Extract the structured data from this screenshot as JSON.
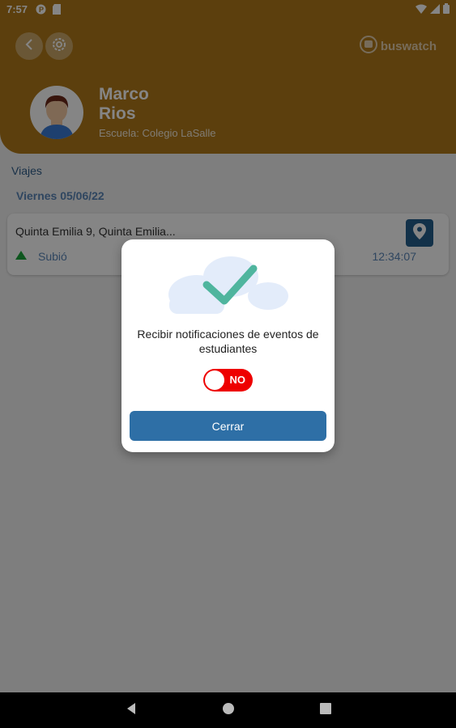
{
  "status_bar": {
    "time": "7:57",
    "icons": [
      "p-circle-icon",
      "sd-card-icon",
      "wifi-icon",
      "signal-icon",
      "battery-icon"
    ]
  },
  "header": {
    "back_icon": "chevron-left-icon",
    "settings_icon": "gear-icon",
    "brand_name": "buswatch",
    "student_first_name": "Marco",
    "student_last_name": "Rios",
    "school": "Escuela: Colegio LaSalle",
    "color": "#b17a1a"
  },
  "content": {
    "section_title": "Viajes",
    "date": "Viernes 05/06/22",
    "trip": {
      "address": "Quinta Emilia 9, Quinta Emilia...",
      "status": "Subió",
      "status_color": "#1aa53a",
      "time": "12:34:07",
      "map_icon": "map-pin-icon"
    }
  },
  "dialog": {
    "illustration": "cloud-check-icon",
    "message": "Recibir notificaciones de eventos de estudiantes",
    "toggle": {
      "state": "off",
      "label": "NO",
      "color": "#ee0000"
    },
    "close_label": "Cerrar",
    "button_color": "#2e6fa6"
  },
  "nav": {
    "back_icon": "nav-back-icon",
    "home_icon": "nav-home-icon",
    "recents_icon": "nav-recents-icon"
  }
}
